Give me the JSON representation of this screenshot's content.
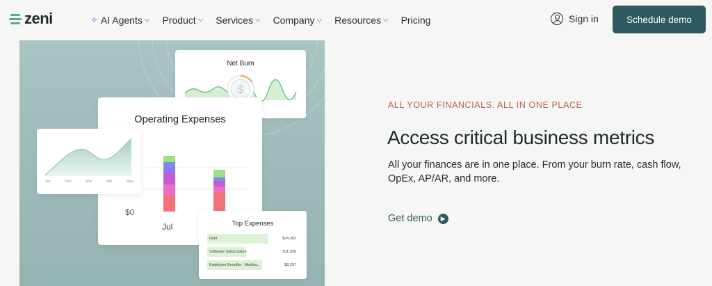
{
  "brand": {
    "name": "zeni"
  },
  "nav": {
    "items": [
      {
        "label": "AI Agents",
        "icon": "sparkle-icon",
        "has_dropdown": true
      },
      {
        "label": "Product",
        "has_dropdown": true
      },
      {
        "label": "Services",
        "has_dropdown": true
      },
      {
        "label": "Company",
        "has_dropdown": true
      },
      {
        "label": "Resources",
        "has_dropdown": true
      },
      {
        "label": "Pricing",
        "has_dropdown": false
      }
    ],
    "signin_label": "Sign in",
    "demo_label": "Schedule demo"
  },
  "hero": {
    "eyebrow": "ALL YOUR FINANCIALS. ALL IN ONE PLACE",
    "headline": "Access critical business metrics",
    "body": "All your finances are in one place. From your burn rate, cash flow, OpEx, AP/AR, and more.",
    "cta_label": "Get demo"
  },
  "illustration": {
    "net_burn_title": "Net Burn",
    "opex_title": "Operating Expenses",
    "opex_zero_label": "$0",
    "opex_month_label": "Jul",
    "area_months": [
      "Jan",
      "Feb",
      "Mar",
      "Apr",
      "May"
    ],
    "top_expenses_title": "Top Expenses",
    "top_expenses": [
      {
        "label": "Rent",
        "value": "$24,302",
        "share": 0.68
      },
      {
        "label": "Software Subscription",
        "value": "$11,926",
        "share": 0.44
      },
      {
        "label": "Employee Benefits - Medica...",
        "value": "$8,297",
        "share": 0.62
      }
    ]
  },
  "colors": {
    "accent": "#2f5960",
    "eyebrow": "#b8654d",
    "logo": "#5aa79b",
    "sparkle": "#9a63d8",
    "panel": "#a3bfbd"
  }
}
